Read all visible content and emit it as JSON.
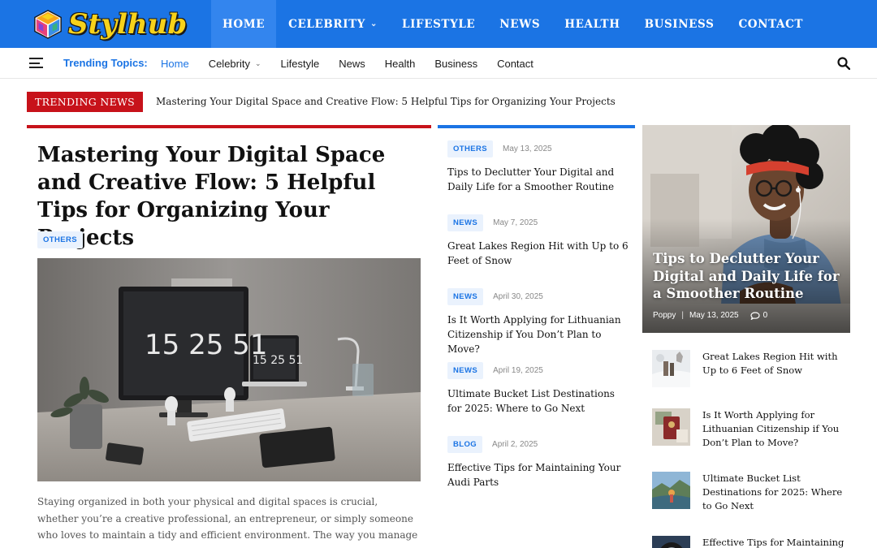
{
  "brand": {
    "name": "Stylhub",
    "colors": {
      "primary": "#1b74e4",
      "accent": "#c7121a",
      "logo_yellow": "#f7d21a"
    }
  },
  "main_nav": [
    {
      "label": "HOME",
      "active": true
    },
    {
      "label": "CELEBRITY",
      "has_dropdown": true
    },
    {
      "label": "LIFESTYLE"
    },
    {
      "label": "NEWS"
    },
    {
      "label": "HEALTH"
    },
    {
      "label": "BUSINESS"
    },
    {
      "label": "CONTACT"
    }
  ],
  "secondary_nav": {
    "trending_label": "Trending Topics:",
    "items": [
      {
        "label": "Home",
        "active": true
      },
      {
        "label": "Celebrity",
        "has_dropdown": true
      },
      {
        "label": "Lifestyle"
      },
      {
        "label": "News"
      },
      {
        "label": "Health"
      },
      {
        "label": "Business"
      },
      {
        "label": "Contact"
      }
    ],
    "icons": {
      "menu": "hamburger-icon",
      "search": "search-icon"
    }
  },
  "ticker": {
    "badge": "TRENDING NEWS",
    "headline": "Mastering Your Digital Space and Creative Flow: 5 Helpful Tips for Organizing Your Projects"
  },
  "lead": {
    "title": "Mastering Your Digital Space and Creative Flow: 5 Helpful Tips for Organizing Your Projects",
    "tag": "OTHERS",
    "image": {
      "clock_large": "15 25 51",
      "clock_small": "15 25 51"
    },
    "excerpt": "Staying organized in both your physical and digital spaces is crucial, whether you’re a creative professional, an entrepreneur, or simply someone who loves to maintain a tidy and efficient environment. The way you manage your time,..."
  },
  "middle_list": [
    {
      "tag": "OTHERS",
      "date": "May 13, 2025",
      "title": "Tips to Declutter Your Digital and Daily Life for a Smoother Routine"
    },
    {
      "tag": "NEWS",
      "date": "May 7, 2025",
      "title": "Great Lakes Region Hit with Up to 6 Feet of Snow"
    },
    {
      "tag": "NEWS",
      "date": "April 30, 2025",
      "title": "Is It Worth Applying for Lithuanian Citizenship if You Don’t Plan to Move?"
    },
    {
      "tag": "NEWS",
      "date": "April 19, 2025",
      "title": "Ultimate Bucket List Destinations for 2025: Where to Go Next"
    },
    {
      "tag": "BLOG",
      "date": "April 2, 2025",
      "title": "Effective Tips for Maintaining Your Audi Parts"
    }
  ],
  "feature": {
    "title": "Tips to Declutter Your Digital and Daily Life for a Smoother Routine",
    "author": "Poppy",
    "separator": "|",
    "date": "May 13, 2025",
    "comments": "0"
  },
  "side_list": [
    {
      "title": "Great Lakes Region Hit with Up to 6 Feet of Snow",
      "thumb": "snow-scene"
    },
    {
      "title": "Is It Worth Applying for Lithuanian Citizenship if You Don’t Plan to Move?",
      "thumb": "passport"
    },
    {
      "title": "Ultimate Bucket List Destinations for 2025: Where to Go Next",
      "thumb": "travel-landscape"
    },
    {
      "title": "Effective Tips for Maintaining",
      "thumb": "car-wheel"
    }
  ]
}
